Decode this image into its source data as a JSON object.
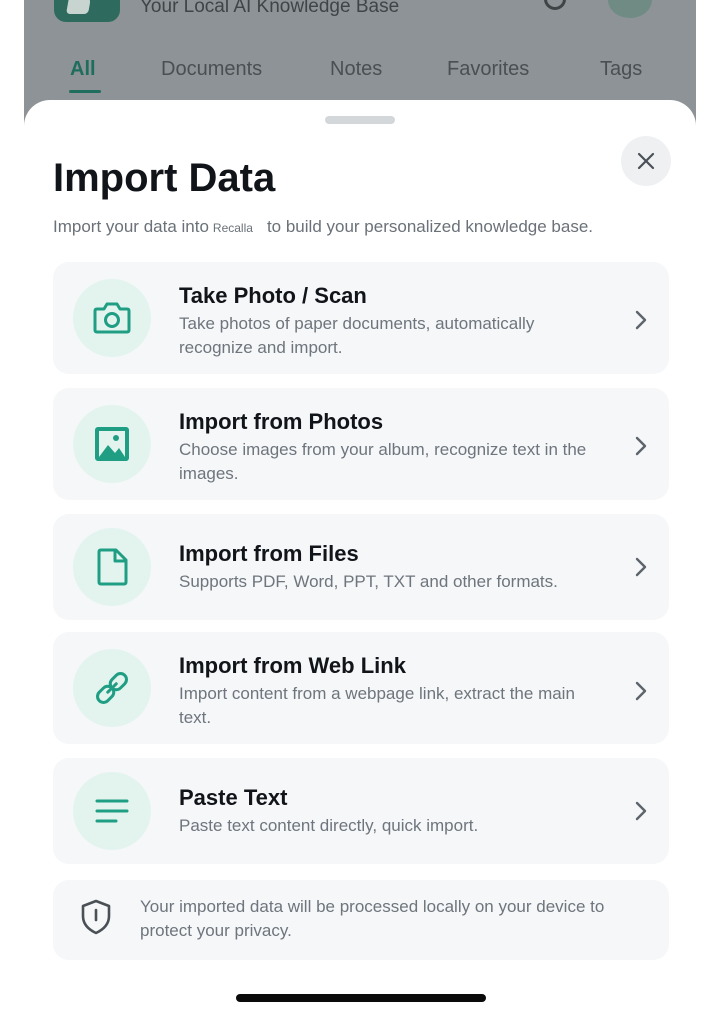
{
  "background": {
    "subtitle": "Your Local AI Knowledge Base",
    "tabs": [
      "All",
      "Documents",
      "Notes",
      "Favorites",
      "Tags"
    ],
    "active_tab": "All"
  },
  "sheet": {
    "title": "Import Data",
    "description_before": "Import your data into",
    "app_name": "Recalla",
    "description_after": "to build your personalized knowledge base.",
    "close_icon": "close-icon",
    "options": [
      {
        "title": "Take Photo / Scan",
        "description": "Take photos of paper documents, automatically recognize and import.",
        "icon": "camera-icon"
      },
      {
        "title": "Import from Photos",
        "description": "Choose images from your album, recognize text in the images.",
        "icon": "image-icon"
      },
      {
        "title": "Import from Files",
        "description": "Supports PDF, Word, PPT, TXT and other formats.",
        "icon": "file-icon"
      },
      {
        "title": "Import from Web Link",
        "description": "Import content from a webpage link, extract the main text.",
        "icon": "link-icon"
      },
      {
        "title": "Paste Text",
        "description": "Paste text content directly, quick import.",
        "icon": "text-lines-icon"
      }
    ],
    "privacy_note": "Your imported data will be processed locally on your device to protect your privacy.",
    "privacy_icon": "shield-icon"
  },
  "colors": {
    "accent": "#1f9e83",
    "icon_bg": "#e3f4ef",
    "card_bg": "#f5f7f9",
    "title": "#111418",
    "muted": "#6e757c"
  }
}
